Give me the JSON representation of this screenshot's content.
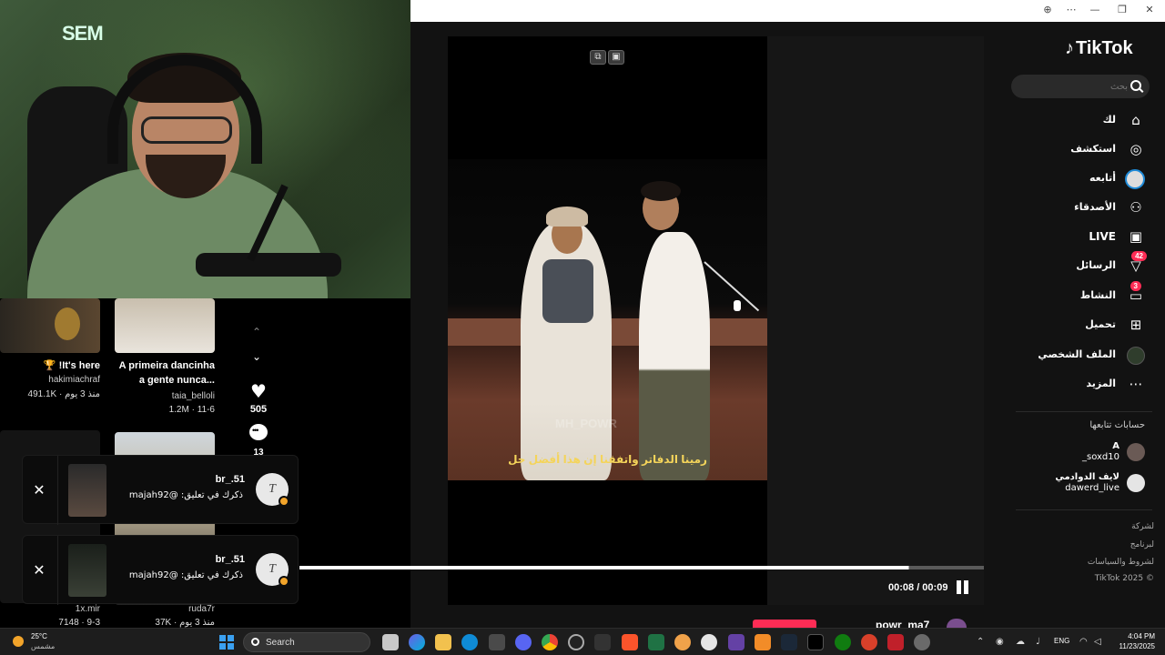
{
  "webcam": {
    "overlay_logo": "SEM"
  },
  "browser": {
    "controls": [
      "⊕",
      "⋯",
      "—",
      "❐",
      "✕"
    ]
  },
  "tiktok": {
    "logo": "TikTok",
    "search": {
      "placeholder": "بحث"
    },
    "nav": [
      {
        "label": "لك",
        "icon": "home-icon",
        "glyph": "⌂"
      },
      {
        "label": "استكشف",
        "icon": "compass-icon",
        "glyph": "◎"
      },
      {
        "label": "أتابعه",
        "icon": "avatar-icon",
        "glyph": ""
      },
      {
        "label": "الأصدقاء",
        "icon": "friends-icon",
        "glyph": "⚇"
      },
      {
        "label": "LIVE",
        "icon": "live-icon",
        "glyph": "▣"
      },
      {
        "label": "الرسائل",
        "icon": "messages-icon",
        "glyph": "▽",
        "badge": "42"
      },
      {
        "label": "النشاط",
        "icon": "activity-icon",
        "glyph": "▭",
        "badge": "3"
      },
      {
        "label": "تحميل",
        "icon": "upload-icon",
        "glyph": "⊞"
      },
      {
        "label": "الملف الشخصي",
        "icon": "profile-icon",
        "glyph": ""
      },
      {
        "label": "المزيد",
        "icon": "more-icon",
        "glyph": "⋯"
      }
    ],
    "following_title": "حسابات تتابعها",
    "following": [
      {
        "name": "A",
        "handle": "_soxd10"
      },
      {
        "name": "لايف الدوادمي",
        "handle": "dawerd_live"
      }
    ],
    "footer": [
      "لشركة",
      "لبرنامج",
      "لشروط والسياسات",
      "TikTok 2025 ©"
    ],
    "video": {
      "subtitle": "رمينا الدفاتر واتفقنا إن هذا أفضل حل",
      "watermark": "MH_POWR",
      "time": "00:08 / 00:09",
      "progress": 0.89,
      "next_author": "powr_ma7"
    },
    "actions": {
      "likes": "505",
      "comments": "13"
    }
  },
  "feed": [
    {
      "title": "🏆 !It's here",
      "author": "hakimiachraf",
      "views": "491.1K",
      "date": "منذ 3 يوم"
    },
    {
      "title": "A primeira dancinha a gente nunca...",
      "author": "taia_belloli",
      "views": "1.2M",
      "date": "11-6"
    },
    {
      "title": "",
      "author": "1x.mir",
      "views": "7148",
      "date": "9-3"
    },
    {
      "title": "",
      "author": "ruda7r",
      "views": "37K",
      "date": "منذ 3 يوم"
    }
  ],
  "notifications": [
    {
      "user": "br_.51",
      "message": "ذكرك في تعليق: @majah92",
      "avatar_letter": "T"
    },
    {
      "user": "br_.51",
      "message": "ذكرك في تعليق: @majah92",
      "avatar_letter": "T"
    }
  ],
  "taskbar": {
    "temp": "25°C",
    "condition": "مشمس",
    "search": "Search",
    "lang": "ENG",
    "time": "4:04 PM",
    "date": "11/23/2025"
  }
}
